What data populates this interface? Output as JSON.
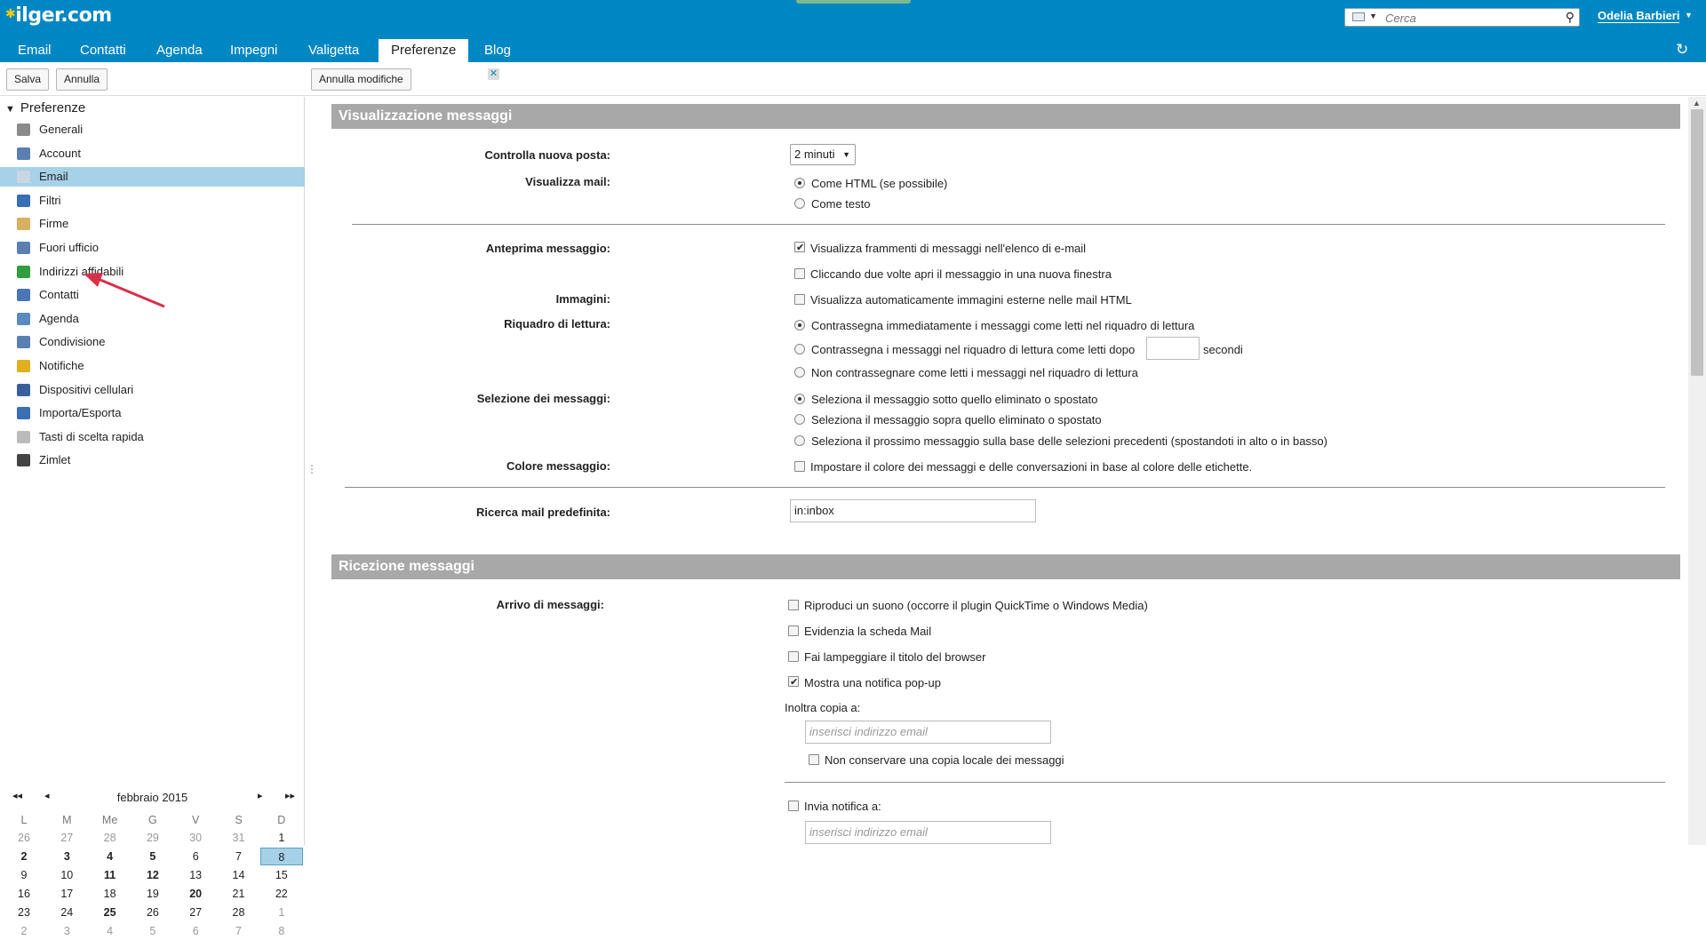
{
  "app": {
    "logo_text": "ilger.com",
    "search_placeholder": "Cerca",
    "user_name": "Odelia Barbieri",
    "tabs": [
      {
        "label": "Email"
      },
      {
        "label": "Contatti"
      },
      {
        "label": "Agenda"
      },
      {
        "label": "Impegni"
      },
      {
        "label": "Valigetta"
      },
      {
        "label": "Preferenze"
      },
      {
        "label": "Blog"
      }
    ]
  },
  "toolbar": {
    "save": "Salva",
    "cancel": "Annulla",
    "undo_changes": "Annulla modifiche"
  },
  "sidebar": {
    "title": "Preferenze",
    "items": [
      {
        "label": "Generali",
        "icon": "gear-icon"
      },
      {
        "label": "Account",
        "icon": "account-icon"
      },
      {
        "label": "Email",
        "icon": "mail-icon"
      },
      {
        "label": "Filtri",
        "icon": "filter-icon"
      },
      {
        "label": "Firme",
        "icon": "signature-icon"
      },
      {
        "label": "Fuori ufficio",
        "icon": "out-of-office-icon"
      },
      {
        "label": "Indirizzi affidabili",
        "icon": "shield-icon"
      },
      {
        "label": "Contatti",
        "icon": "contacts-icon"
      },
      {
        "label": "Agenda",
        "icon": "calendar-icon"
      },
      {
        "label": "Condivisione",
        "icon": "sharing-icon"
      },
      {
        "label": "Notifiche",
        "icon": "bell-icon"
      },
      {
        "label": "Dispositivi cellulari",
        "icon": "mobile-icon"
      },
      {
        "label": "Importa/Esporta",
        "icon": "import-export-icon"
      },
      {
        "label": "Tasti di scelta rapida",
        "icon": "keyboard-icon"
      },
      {
        "label": "Zimlet",
        "icon": "zimlet-icon"
      }
    ],
    "selected": "Email"
  },
  "calendar": {
    "month_title": "febbraio 2015",
    "nav": {
      "prev_year": "◂◂",
      "prev": "◂",
      "next": "▸",
      "next_year": "▸▸"
    },
    "weekdays": [
      "L",
      "M",
      "Me",
      "G",
      "V",
      "S",
      "D"
    ],
    "weeks": [
      [
        {
          "d": "26",
          "o": 1
        },
        {
          "d": "27",
          "o": 1
        },
        {
          "d": "28",
          "o": 1
        },
        {
          "d": "29",
          "o": 1
        },
        {
          "d": "30",
          "o": 1
        },
        {
          "d": "31",
          "o": 1
        },
        {
          "d": "1"
        }
      ],
      [
        {
          "d": "2",
          "b": 1
        },
        {
          "d": "3",
          "b": 1
        },
        {
          "d": "4",
          "b": 1
        },
        {
          "d": "5",
          "b": 1
        },
        {
          "d": "6"
        },
        {
          "d": "7"
        },
        {
          "d": "8",
          "t": 1
        }
      ],
      [
        {
          "d": "9"
        },
        {
          "d": "10"
        },
        {
          "d": "11",
          "b": 1
        },
        {
          "d": "12",
          "b": 1
        },
        {
          "d": "13"
        },
        {
          "d": "14"
        },
        {
          "d": "15"
        }
      ],
      [
        {
          "d": "16"
        },
        {
          "d": "17"
        },
        {
          "d": "18"
        },
        {
          "d": "19"
        },
        {
          "d": "20",
          "b": 1
        },
        {
          "d": "21"
        },
        {
          "d": "22"
        }
      ],
      [
        {
          "d": "23"
        },
        {
          "d": "24"
        },
        {
          "d": "25",
          "b": 1
        },
        {
          "d": "26"
        },
        {
          "d": "27"
        },
        {
          "d": "28"
        },
        {
          "d": "1",
          "o": 1
        }
      ],
      [
        {
          "d": "2",
          "o": 1
        },
        {
          "d": "3",
          "o": 1
        },
        {
          "d": "4",
          "o": 1
        },
        {
          "d": "5",
          "o": 1
        },
        {
          "d": "6",
          "o": 1
        },
        {
          "d": "7",
          "o": 1
        },
        {
          "d": "8",
          "o": 1
        }
      ]
    ]
  },
  "sections": {
    "display": {
      "title": "Visualizzazione messaggi",
      "check_mail_label": "Controlla nuova posta:",
      "check_mail_value": "2 minuti",
      "view_mail_label": "Visualizza mail:",
      "view_html": "Come HTML (se possibile)",
      "view_text": "Come testo",
      "preview_label": "Anteprima messaggio:",
      "preview_snippets": "Visualizza frammenti di messaggi nell'elenco di e-mail",
      "preview_double_click": "Cliccando due volte apri il messaggio in una nuova finestra",
      "images_label": "Immagini:",
      "images_auto": "Visualizza automaticamente immagini esterne nelle mail HTML",
      "reading_pane_label": "Riquadro di lettura:",
      "reading_immediate": "Contrassegna immediatamente i messaggi come letti nel riquadro di lettura",
      "reading_after": "Contrassegna i messaggi nel riquadro di lettura come letti dopo",
      "reading_seconds": "secondi",
      "reading_never": "Non contrassegnare come letti i messaggi nel riquadro di lettura",
      "selection_label": "Selezione dei messaggi:",
      "selection_below": "Seleziona il messaggio sotto quello eliminato o spostato",
      "selection_above": "Seleziona il messaggio sopra quello eliminato o spostato",
      "selection_next": "Seleziona il prossimo messaggio sulla base delle selezioni precedenti (spostandoti in alto o in basso)",
      "color_label": "Colore messaggio:",
      "color_option": "Impostare il colore dei messaggi e delle conversazioni in base al colore delle etichette.",
      "default_search_label": "Ricerca mail predefinita:",
      "default_search_value": "in:inbox"
    },
    "receive": {
      "title": "Ricezione messaggi",
      "arrival_label": "Arrivo di messaggi:",
      "play_sound": "Riproduci un suono (occorre il plugin QuickTime o Windows Media)",
      "highlight_tab": "Evidenzia la scheda Mail",
      "flash_title": "Fai lampeggiare il titolo del browser",
      "popup": "Mostra una notifica pop-up",
      "forward_label": "Inoltra copia a:",
      "forward_placeholder": "inserisci indirizzo email",
      "no_local_copy": "Non conservare una copia locale dei messaggi",
      "send_notification": "Invia notifica a:",
      "notify_placeholder": "inserisci indirizzo email"
    }
  },
  "colors": {
    "header_bg": "#0087c3",
    "selected_bg": "#a6d1e8",
    "section_bg": "#a8a8a8",
    "arrow": "#d9304a"
  }
}
